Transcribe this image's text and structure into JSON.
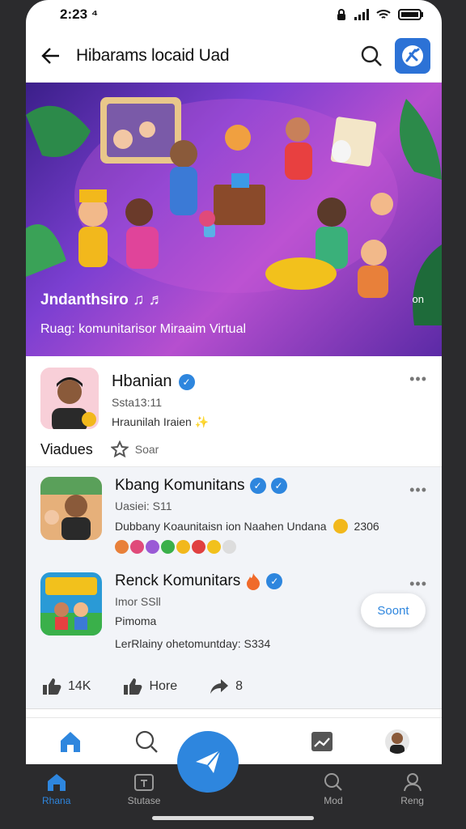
{
  "status": {
    "time": "2:23 ⁴"
  },
  "appbar": {
    "title": "Hibarams locaid Uad"
  },
  "hero": {
    "title": "Jndanthsiro ♫ ♬",
    "subtitle": "Ruag: komunitarisor Miraaim Virtual",
    "badge": "on"
  },
  "profile": {
    "name": "Hbanian",
    "meta": "Ssta13:11",
    "tagline": "Hraunilah Iraien ✨"
  },
  "tabs": {
    "first": "Viadues",
    "second": "Soar"
  },
  "posts": [
    {
      "title": "Kbang Komunitans",
      "meta": "Uasiei: S11",
      "desc": "Dubbany Koaunitaisn ion Naahen Undana",
      "count": "2306"
    },
    {
      "title": "Renck Komunitars",
      "meta": "Imor SSll",
      "desc": "Pimoma",
      "extra": "LerRlainy ohetomuntday:  S334",
      "follow": "Soont"
    }
  ],
  "actions": {
    "likes": "14K",
    "more": "Hore",
    "shares": "8"
  },
  "bottom_nav": [
    {
      "label": "Rhana"
    },
    {
      "label": "Stutase"
    },
    {
      "label": "Mod"
    },
    {
      "label": "Reng"
    }
  ],
  "colors": {
    "accent": "#2e86de",
    "brand_tile": "#2c72d6"
  }
}
